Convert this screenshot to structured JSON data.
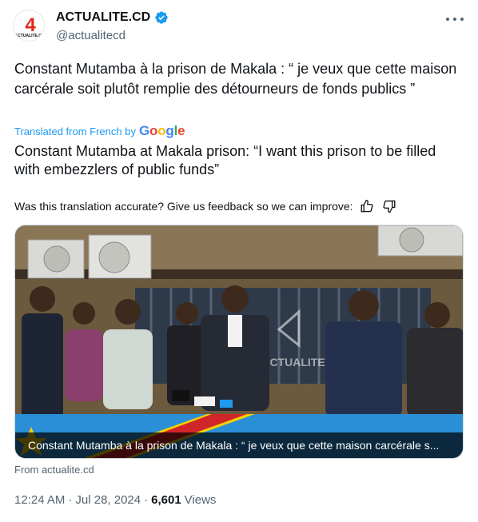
{
  "author": {
    "display_name": "ACTUALITE.CD",
    "handle": "@actualitecd",
    "avatar_text": "ACTUALITE.CD",
    "verified": true
  },
  "tweet": {
    "original_text": "Constant Mutamba à la prison de Makala : “ je veux que cette maison carcérale soit plutôt remplie des détourneurs de fonds publics ”",
    "translated_label": "Translated from French by",
    "translator_brand": "Google",
    "translated_text": "Constant Mutamba at Makala prison: “I want this prison to be filled with embezzlers of public funds”",
    "feedback_prompt": "Was this translation accurate? Give us feedback so we can improve:"
  },
  "media": {
    "caption": "Constant Mutamba à la prison de Makala : “ je veux que cette maison carcérale s...",
    "watermark": "ACTUALITE"
  },
  "from_label": "From actualite.cd",
  "meta": {
    "time": "12:24 AM",
    "date": "Jul 28, 2024",
    "views_count": "6,601",
    "views_label": "Views"
  },
  "colors": {
    "link_blue": "#1d9bf0",
    "secondary": "#536471",
    "brand_red": "#e1261c",
    "verified_blue": "#1d9bf0"
  }
}
